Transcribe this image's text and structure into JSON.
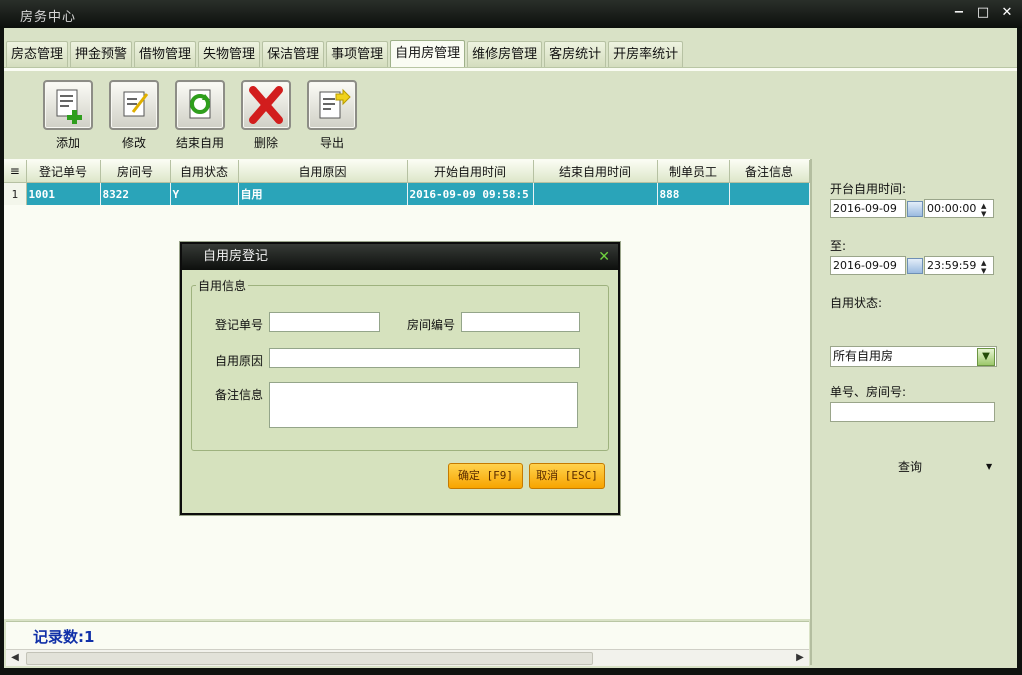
{
  "window": {
    "title": "房务中心",
    "controls": [
      "−",
      "□",
      "✕"
    ]
  },
  "tabs": [
    {
      "label": "房态管理",
      "active": false
    },
    {
      "label": "押金预警",
      "active": false
    },
    {
      "label": "借物管理",
      "active": false
    },
    {
      "label": "失物管理",
      "active": false
    },
    {
      "label": "保洁管理",
      "active": false
    },
    {
      "label": "事项管理",
      "active": false
    },
    {
      "label": "自用房管理",
      "active": true
    },
    {
      "label": "维修房管理",
      "active": false
    },
    {
      "label": "客房统计",
      "active": false
    },
    {
      "label": "开房率统计",
      "active": false
    }
  ],
  "toolbar": {
    "add": "添加",
    "edit": "修改",
    "end_self_use": "结束自用",
    "delete": "删除",
    "export": "导出"
  },
  "grid": {
    "columns": [
      "登记单号",
      "房间号",
      "自用状态",
      "自用原因",
      "开始自用时间",
      "结束自用时间",
      "制单员工",
      "备注信息"
    ],
    "rows": [
      {
        "num": "1",
        "cells": [
          "1001",
          "8322",
          "Y",
          "自用",
          "2016-09-09 09:58:5",
          "",
          "888",
          ""
        ]
      }
    ]
  },
  "status": {
    "record_count": "记录数:1"
  },
  "filters": {
    "start_label": "开台自用时间:",
    "start_date": "2016-09-09",
    "start_time": "00:00:00",
    "to_label": "至:",
    "end_date": "2016-09-09",
    "end_time": "23:59:59",
    "status_label": "自用状态:",
    "status_value": "所有自用房",
    "number_label": "单号、房间号:",
    "number_value": "",
    "query_button": "查询"
  },
  "dialog": {
    "title": "自用房登记",
    "group": "自用信息",
    "fields": {
      "reg_no_label": "登记单号",
      "room_no_label": "房间编号",
      "reason_label": "自用原因",
      "note_label": "备注信息"
    },
    "confirm": "确定 [F9]",
    "cancel": "取消 [ESC]"
  },
  "colors": {
    "accent": "#2aa4b9",
    "panel": "#d9e2c6",
    "button": "#f7a400"
  }
}
